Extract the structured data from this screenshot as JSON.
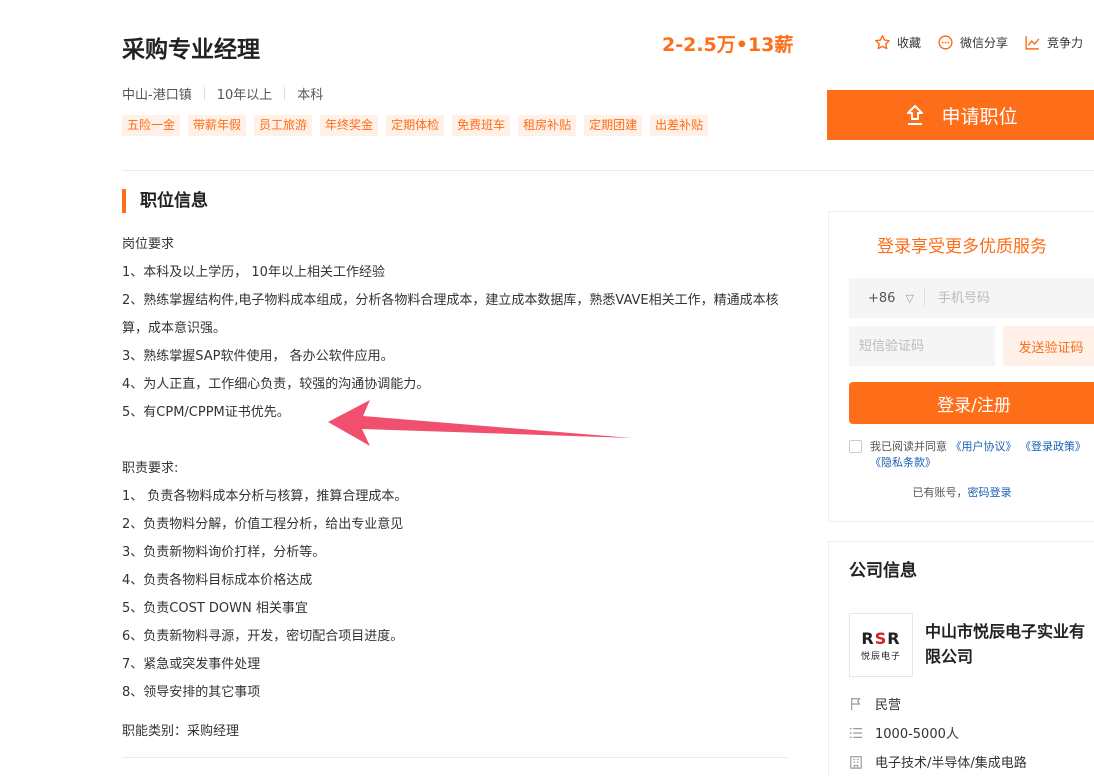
{
  "job": {
    "title": "采购专业经理",
    "salary": "2-2.5万•13薪",
    "location": "中山-港口镇",
    "experience": "10年以上",
    "education": "本科",
    "tags": [
      "五险一金",
      "带薪年假",
      "员工旅游",
      "年终奖金",
      "定期体检",
      "免费班车",
      "租房补贴",
      "定期团建",
      "出差补贴"
    ]
  },
  "actions": {
    "favorite": "收藏",
    "wechat_share": "微信分享",
    "compete": "竞争力"
  },
  "apply_button": "申请职位",
  "section": {
    "title": "职位信息",
    "requirements_heading": "岗位要求",
    "requirements": [
      "1、本科及以上学历， 10年以上相关工作经验",
      "2、熟练掌握结构件,电子物料成本组成，分析各物料合理成本，建立成本数据库，熟悉VAVE相关工作，精通成本核算，成本意识强。",
      "3、熟练掌握SAP软件使用， 各办公软件应用。",
      "4、为人正直，工作细心负责，较强的沟通协调能力。",
      "5、有CPM/CPPM证书优先。"
    ],
    "duties_heading": "职责要求:",
    "duties": [
      "1、 负责各物料成本分析与核算，推算合理成本。",
      "2、负责物料分解，价值工程分析，给出专业意见",
      "3、负责新物料询价打样，分析等。",
      "4、负责各物料目标成本价格达成",
      "5、负责COST DOWN 相关事宜",
      "6、负责新物料寻源，开发，密切配合项目进度。",
      "7、紧急或突发事件处理",
      "8、领导安排的其它事项"
    ],
    "function_category": "职能类别：采购经理"
  },
  "login": {
    "title": "登录享受更多优质服务",
    "country_code": "+86",
    "phone_placeholder": "手机号码",
    "code_placeholder": "短信验证码",
    "send_code": "发送验证码",
    "submit": "登录/注册",
    "agree_prefix": "我已阅读并同意",
    "user_agreement": "《用户协议》",
    "login_policy": "《登录政策》",
    "privacy_terms": "《隐私条款》",
    "has_account": "已有账号，",
    "password_login": "密码登录"
  },
  "company": {
    "section_title": "公司信息",
    "logo_text": "RSR",
    "logo_sub": "悦辰电子",
    "name": "中山市悦辰电子实业有限公司",
    "type": "民营",
    "size": "1000-5000人",
    "industry": "电子技术/半导体/集成电路"
  },
  "colors": {
    "accent": "#fe6d17",
    "tag_bg": "#fff1e8",
    "link": "#1a5fb4",
    "arrow": "#f0506e"
  }
}
